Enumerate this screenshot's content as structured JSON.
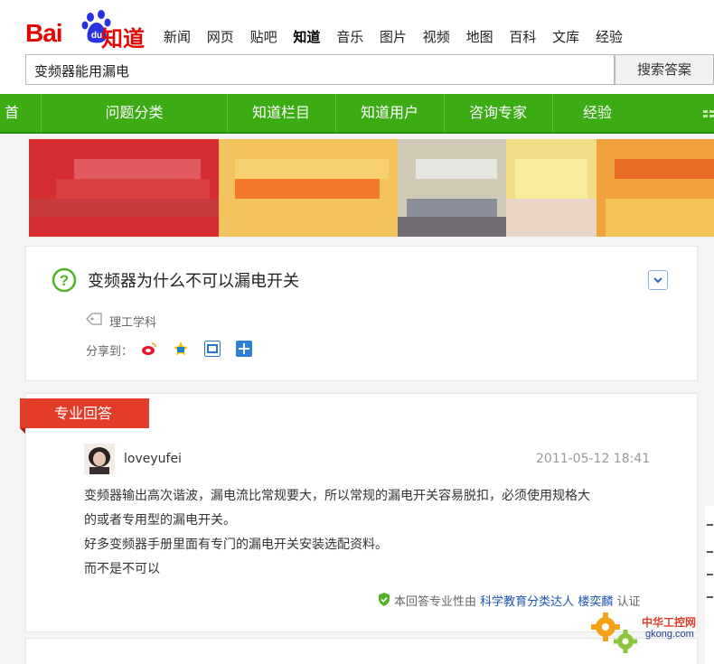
{
  "header": {
    "logo": {
      "bai": "Bai",
      "du": "du",
      "zhidao": "知道"
    },
    "nav": [
      "新闻",
      "网页",
      "贴吧",
      "知道",
      "音乐",
      "图片",
      "视频",
      "地图",
      "百科",
      "文库",
      "经验"
    ],
    "nav_active_index": 3,
    "search_value": "变频器能用漏电",
    "search_button": "搜索答案"
  },
  "greenbar": {
    "items": [
      "首页",
      "问题分类",
      "知道栏目",
      "知道用户",
      "咨询专家",
      "经验"
    ]
  },
  "question": {
    "title": "变频器为什么不可以漏电开关",
    "tag": "理工学科",
    "share_label": "分享到："
  },
  "answer": {
    "section_label": "专业回答",
    "username": "loveyufei",
    "date": "2011-05-12 18:41",
    "paragraphs": [
      "变频器输出高次谐波，漏电流比常规要大，所以常规的漏电开关容易脱扣，必须使用规格大",
      "的或者专用型的漏电开关。",
      "好多变频器手册里面有专门的漏电开关安装选配资料。",
      "而不是不可以"
    ],
    "cert_prefix": "本回答专业性由",
    "cert_category": "科学教育分类达人",
    "cert_person": "楼奕麟",
    "cert_suffix": "认证"
  },
  "watermark": {
    "text": "中华工控网",
    "url": "gkong.com"
  },
  "colors": {
    "baidu_red": "#e10601",
    "baidu_blue": "#2932e1",
    "nav_green": "#3dab14",
    "ribbon_red": "#e43c2a",
    "link_blue": "#1a55b5"
  }
}
